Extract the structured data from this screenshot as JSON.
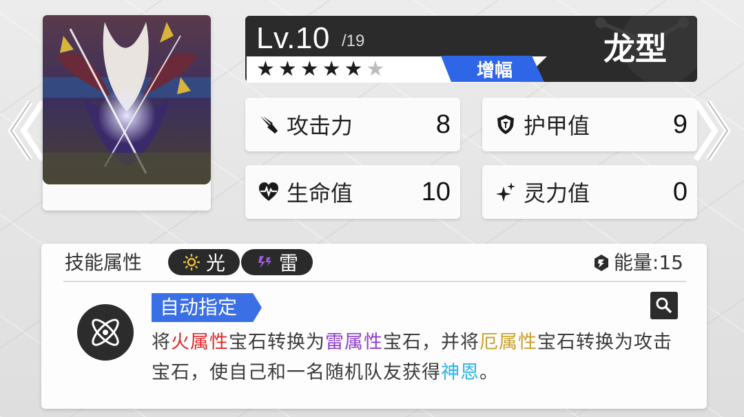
{
  "level": {
    "current": "Lv.10",
    "max": "/19"
  },
  "type_name": "龙型",
  "stars": {
    "filled": 5,
    "total": 6
  },
  "boost_label": "增幅",
  "stats": {
    "attack": {
      "label": "攻击力",
      "value": "8"
    },
    "armor": {
      "label": "护甲值",
      "value": "9"
    },
    "hp": {
      "label": "生命值",
      "value": "10"
    },
    "spirit": {
      "label": "灵力值",
      "value": "0"
    }
  },
  "skill": {
    "attr_label": "技能属性",
    "attributes": [
      {
        "name": "光",
        "icon": "light-icon",
        "color": "#e6c23a"
      },
      {
        "name": "雷",
        "icon": "thunder-icon",
        "color": "#9a5ad6"
      }
    ],
    "energy": "能量:15",
    "tag": "自动指定",
    "description": {
      "p1": "将",
      "k1": "火属性",
      "p2": "宝石转换为",
      "k2": "雷属性",
      "p3": "宝石，并将",
      "k3": "厄属性",
      "p4": "宝石转换为攻击宝石，使自己和一名随机队友获得",
      "k4": "神恩",
      "p5": "。"
    }
  },
  "colors": {
    "header_bg": "#2b2b2b",
    "boost_blue": "#2f66e8",
    "fire": "#e02a2a",
    "thunder": "#8f3fc8",
    "curse": "#c8a12a",
    "grace": "#2ab3e6"
  },
  "icons": {
    "nav_left": "chevron-left-icon",
    "nav_right": "chevron-right-icon",
    "attack": "sword-icon",
    "armor": "shield-icon",
    "hp": "heart-icon",
    "spirit": "sparkle-icon",
    "energy": "energy-icon",
    "skill": "atom-icon",
    "magnify": "magnify-icon"
  }
}
